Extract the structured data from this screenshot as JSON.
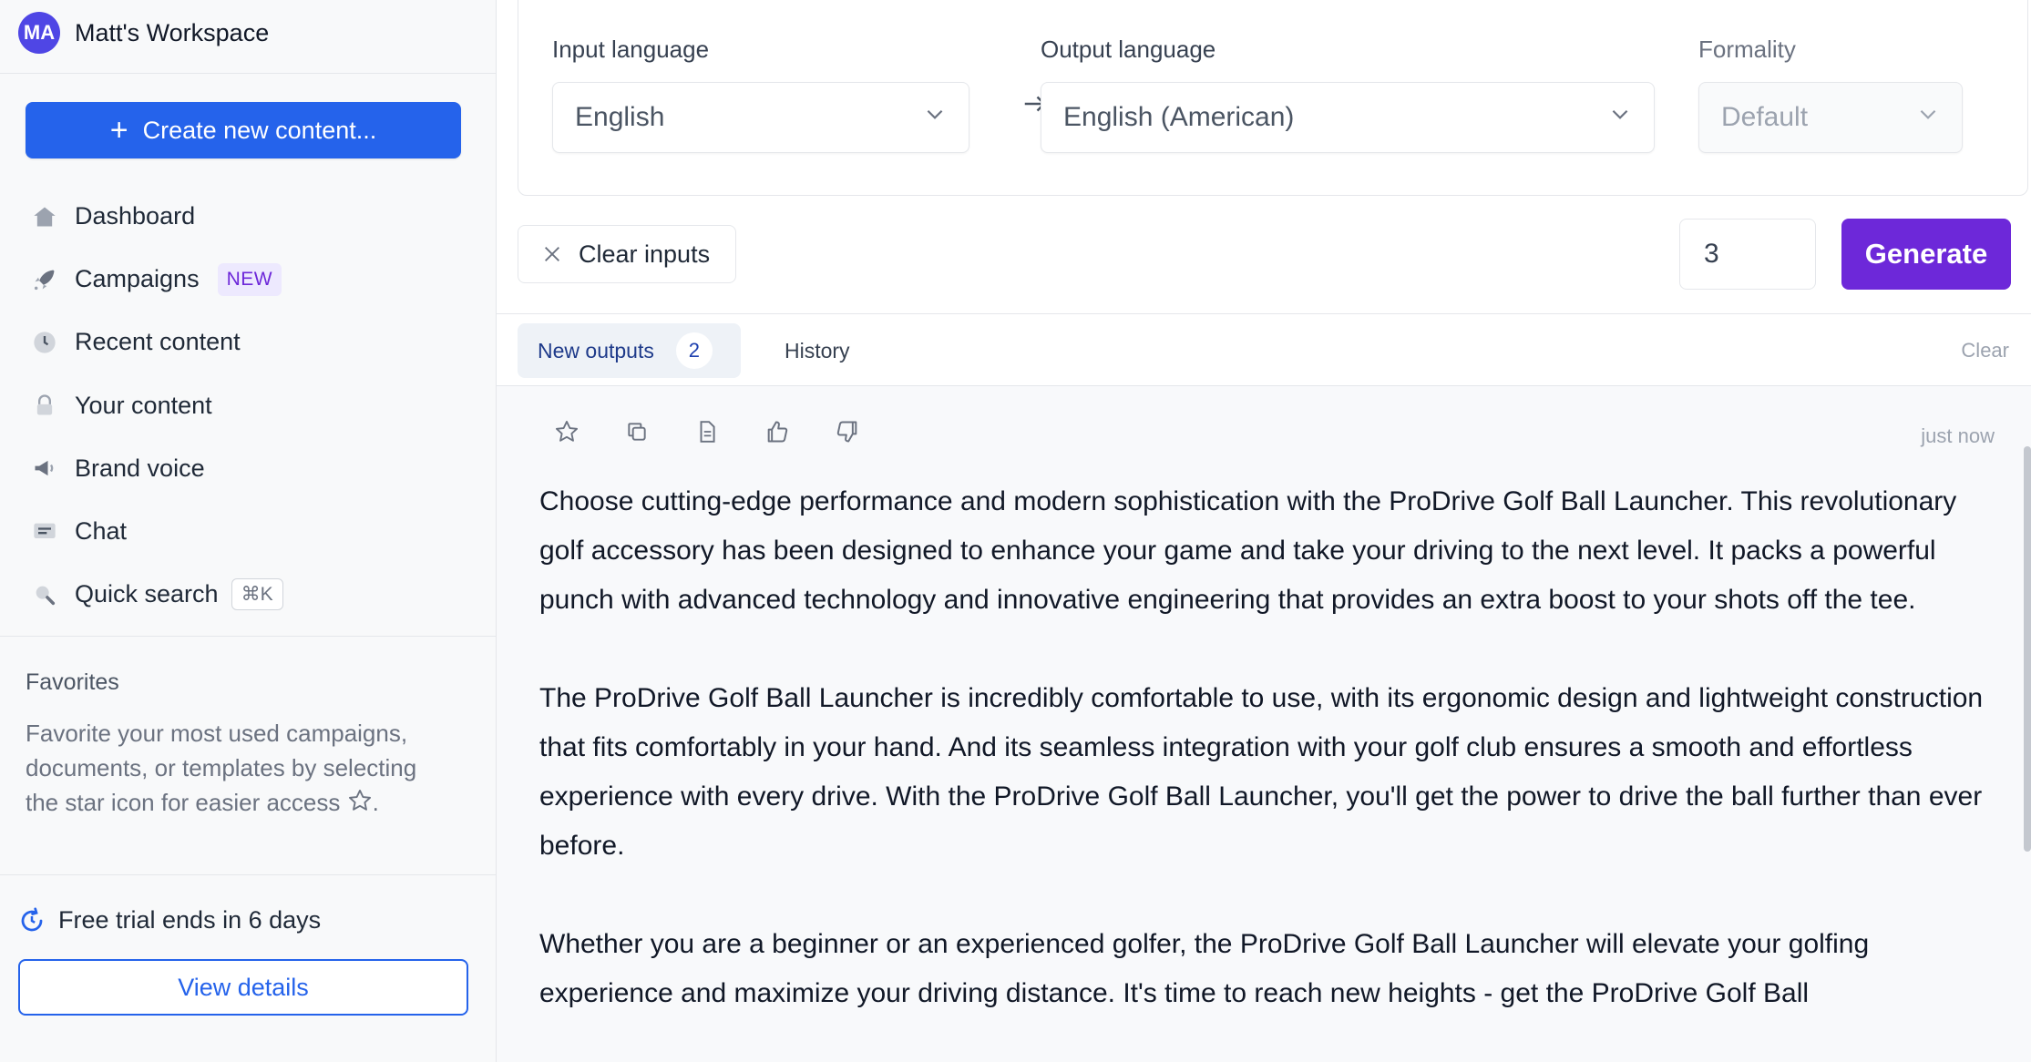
{
  "workspace": {
    "avatar_initials": "MA",
    "name": "Matt's Workspace"
  },
  "sidebar": {
    "create_button": "Create new content...",
    "nav": [
      {
        "label": "Dashboard",
        "icon": "home-icon"
      },
      {
        "label": "Campaigns",
        "icon": "rocket-icon",
        "badge": "NEW"
      },
      {
        "label": "Recent content",
        "icon": "clock-icon"
      },
      {
        "label": "Your content",
        "icon": "lock-icon"
      },
      {
        "label": "Brand voice",
        "icon": "megaphone-icon"
      },
      {
        "label": "Chat",
        "icon": "chat-icon"
      },
      {
        "label": "Quick search",
        "icon": "search-icon",
        "shortcut": "⌘K"
      }
    ],
    "favorites": {
      "title": "Favorites",
      "text": "Favorite your most used campaigns, documents, or templates by selecting the star icon for easier access",
      "suffix": "."
    },
    "trial_text": "Free trial ends in 6 days",
    "view_details": "View details"
  },
  "settings": {
    "input_label": "Input language",
    "input_value": "English",
    "output_label": "Output language",
    "output_value": "English (American)",
    "formality_label": "Formality",
    "formality_value": "Default"
  },
  "toolbar": {
    "clear_inputs": "Clear inputs",
    "count": "3",
    "generate": "Generate"
  },
  "tabs": {
    "new_outputs": "New outputs",
    "new_outputs_count": "2",
    "history": "History",
    "clear": "Clear"
  },
  "output": {
    "timestamp": "just now",
    "paragraphs": [
      "Choose cutting-edge performance and modern sophistication with the ProDrive Golf Ball Launcher. This revolutionary golf accessory has been designed to enhance your game and take your driving to the next level. It packs a powerful punch with advanced technology and innovative engineering that provides an extra boost to your shots off the tee.",
      "The ProDrive Golf Ball Launcher is incredibly comfortable to use, with its ergonomic design and lightweight construction that fits comfortably in your hand. And its seamless integration with your golf club ensures a smooth and effortless experience with every drive. With the ProDrive Golf Ball Launcher, you'll get the power to drive the ball further than ever before.",
      "Whether you are a beginner or an experienced golfer, the ProDrive Golf Ball Launcher will elevate your golfing experience and maximize your driving distance. It's time to reach new heights - get the ProDrive Golf Ball"
    ]
  },
  "colors": {
    "primary": "#2563eb",
    "generate": "#6d28d9",
    "avatar": "#4f46e5"
  }
}
